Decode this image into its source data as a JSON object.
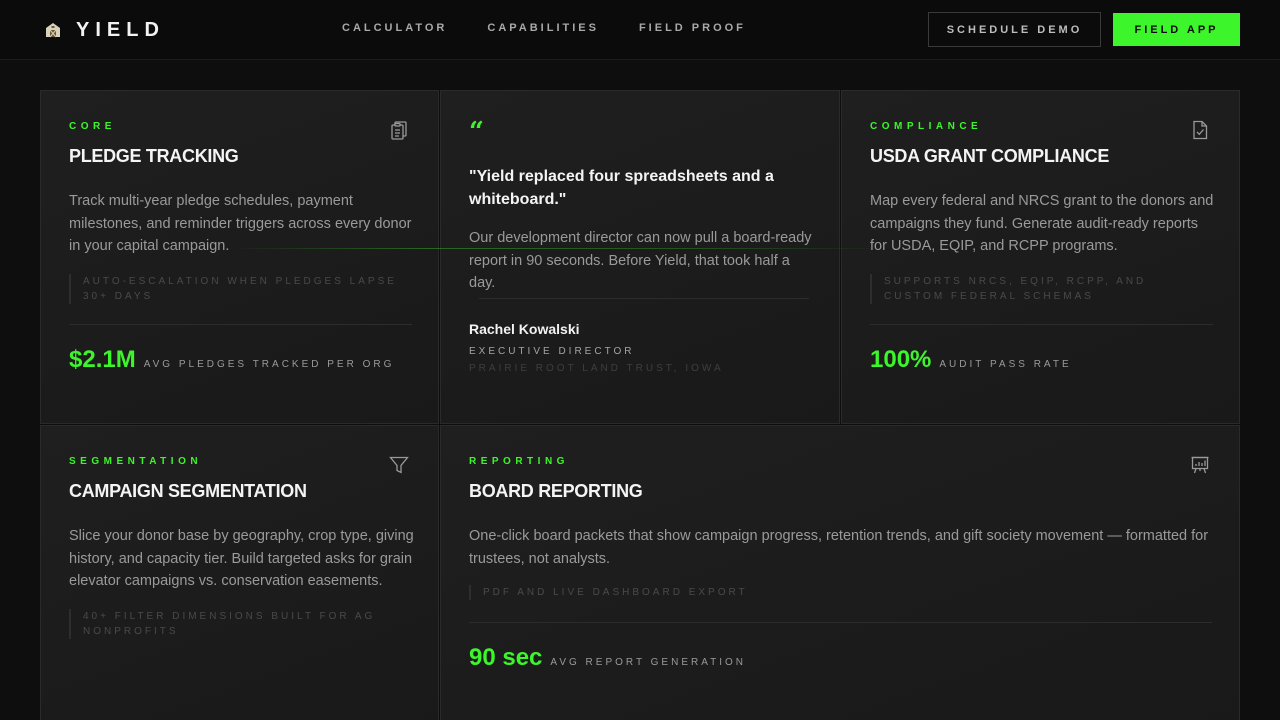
{
  "header": {
    "brand": "YIELD",
    "nav": [
      "CALCULATOR",
      "CAPABILITIES",
      "FIELD PROOF"
    ],
    "demo_button": "SCHEDULE DEMO",
    "app_button": "FIELD APP"
  },
  "cards": {
    "pledge": {
      "eyebrow": "CORE",
      "title": "PLEDGE TRACKING",
      "icon": "clipboard-icon",
      "description": "Track multi-year pledge schedules, payment milestones, and reminder triggers across every donor in your capital campaign.",
      "note": "AUTO-ESCALATION WHEN PLEDGES LAPSE 30+ DAYS",
      "stat_value": "$2.1M",
      "stat_label": "AVG PLEDGES TRACKED PER ORG"
    },
    "testimonial": {
      "quote_mark": "“",
      "quote": "\"Yield replaced four spreadsheets and a whiteboard.\"",
      "body": "Our development director can now pull a board-ready report in 90 seconds. Before Yield, that took half a day.",
      "author": "Rachel Kowalski",
      "role": "EXECUTIVE DIRECTOR",
      "org": "PRAIRIE ROOT LAND TRUST, IOWA"
    },
    "compliance": {
      "eyebrow": "COMPLIANCE",
      "title": "USDA GRANT COMPLIANCE",
      "icon": "file-check-icon",
      "description": "Map every federal and NRCS grant to the donors and campaigns they fund. Generate audit-ready reports for USDA, EQIP, and RCPP programs.",
      "note": "SUPPORTS NRCS, EQIP, RCPP, AND CUSTOM FEDERAL SCHEMAS",
      "stat_value": "100%",
      "stat_label": "AUDIT PASS RATE"
    },
    "segmentation": {
      "eyebrow": "SEGMENTATION",
      "title": "CAMPAIGN SEGMENTATION",
      "icon": "filter-icon",
      "description": "Slice your donor base by geography, crop type, giving history, and capacity tier. Build targeted asks for grain elevator campaigns vs. conservation easements.",
      "note": "40+ FILTER DIMENSIONS BUILT FOR AG NONPROFITS"
    },
    "reporting": {
      "eyebrow": "REPORTING",
      "title": "BOARD REPORTING",
      "icon": "presentation-chart-icon",
      "description": "One-click board packets that show campaign progress, retention trends, and gift society movement — formatted for trustees, not analysts.",
      "note": "PDF AND LIVE DASHBOARD EXPORT",
      "stat_value": "90 sec",
      "stat_label": "AVG REPORT GENERATION"
    }
  },
  "colors": {
    "accent": "#3cf52a",
    "background": "#0e0e0e",
    "card": "#1e1e1e"
  }
}
